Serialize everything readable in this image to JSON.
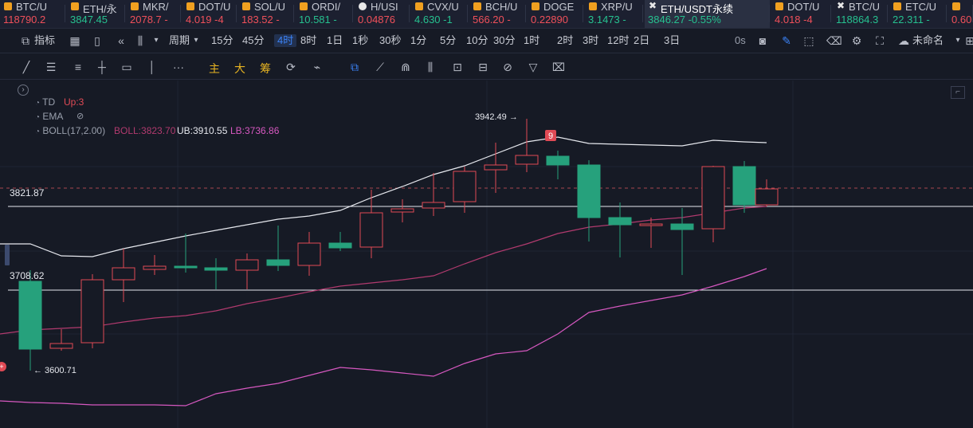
{
  "tickers": [
    {
      "symbol": "BTC/U",
      "value": "118790.2",
      "dir": "dn",
      "icon": "orange-square-icon"
    },
    {
      "symbol": "ETH/永",
      "value": "3847.45",
      "dir": "up",
      "icon": "orange-square-icon"
    },
    {
      "symbol": "MKR/",
      "value": "2078.7 -",
      "dir": "dn",
      "icon": "orange-square-icon"
    },
    {
      "symbol": "DOT/U",
      "value": "4.019 -4",
      "dir": "dn",
      "icon": "orange-square-icon"
    },
    {
      "symbol": "SOL/U",
      "value": "183.52 -",
      "dir": "dn",
      "icon": "orange-square-icon"
    },
    {
      "symbol": "ORDI/",
      "value": "10.581 -",
      "dir": "up",
      "icon": "orange-square-icon"
    },
    {
      "symbol": "H/USI",
      "value": "0.04876",
      "dir": "dn",
      "icon": "white-circle-icon"
    },
    {
      "symbol": "CVX/U",
      "value": "4.630 -1",
      "dir": "up",
      "icon": "orange-square-icon"
    },
    {
      "symbol": "BCH/U",
      "value": "566.20 -",
      "dir": "dn",
      "icon": "orange-square-icon"
    },
    {
      "symbol": "DOGE",
      "value": "0.22890",
      "dir": "dn",
      "icon": "orange-square-icon"
    },
    {
      "symbol": "XRP/U",
      "value": "3.1473 -",
      "dir": "up",
      "icon": "orange-square-icon"
    },
    {
      "symbol": "ETH/USDT永续",
      "value": "3846.27 -0.55%",
      "dir": "up",
      "icon": "x-cross-icon"
    },
    {
      "symbol": "DOT/U",
      "value": "4.018 -4",
      "dir": "dn",
      "icon": "orange-square-icon"
    },
    {
      "symbol": "BTC/U",
      "value": "118864.3",
      "dir": "up",
      "icon": "x-cross-icon"
    },
    {
      "symbol": "ETC/U",
      "value": "22.311 -",
      "dir": "up",
      "icon": "orange-square-icon"
    },
    {
      "symbol": "",
      "value": "0.60",
      "dir": "dn",
      "icon": "orange-square-icon"
    }
  ],
  "toolbar": {
    "indicator_label": "指标",
    "period_label": "周期",
    "intervals": [
      "15分",
      "45分",
      "4时",
      "8时",
      "1日",
      "1秒",
      "30秒",
      "1分",
      "5分",
      "10分",
      "30分",
      "1时",
      "2时",
      "3时",
      "12时",
      "2日",
      "3日"
    ],
    "selected_interval": "4时",
    "countdown": "0s",
    "layout_name": "未命名"
  },
  "drawing_toolbar": {
    "labels": [
      "主",
      "大",
      "筹"
    ]
  },
  "indicators": {
    "td_name": "TD",
    "td_value": "Up:3",
    "ema_name": "EMA",
    "boll_name": "BOLL(17,2.00)",
    "boll_mid": "BOLL:3823.70",
    "boll_ub": "UB:3910.55",
    "boll_lb": "LB:3736.86"
  },
  "annotations": {
    "high_label": "3942.49 →",
    "low_label": "← 3600.71",
    "td_badge": "9"
  },
  "price_lines": [
    {
      "label": "3821.87"
    },
    {
      "label": "3708.62"
    }
  ],
  "colors": {
    "bull": "#26a17c",
    "bear": "#e04a55",
    "boll_upper": "#e6e8ee",
    "boll_mid": "#b13a6e",
    "boll_lower": "#d658c0"
  }
}
